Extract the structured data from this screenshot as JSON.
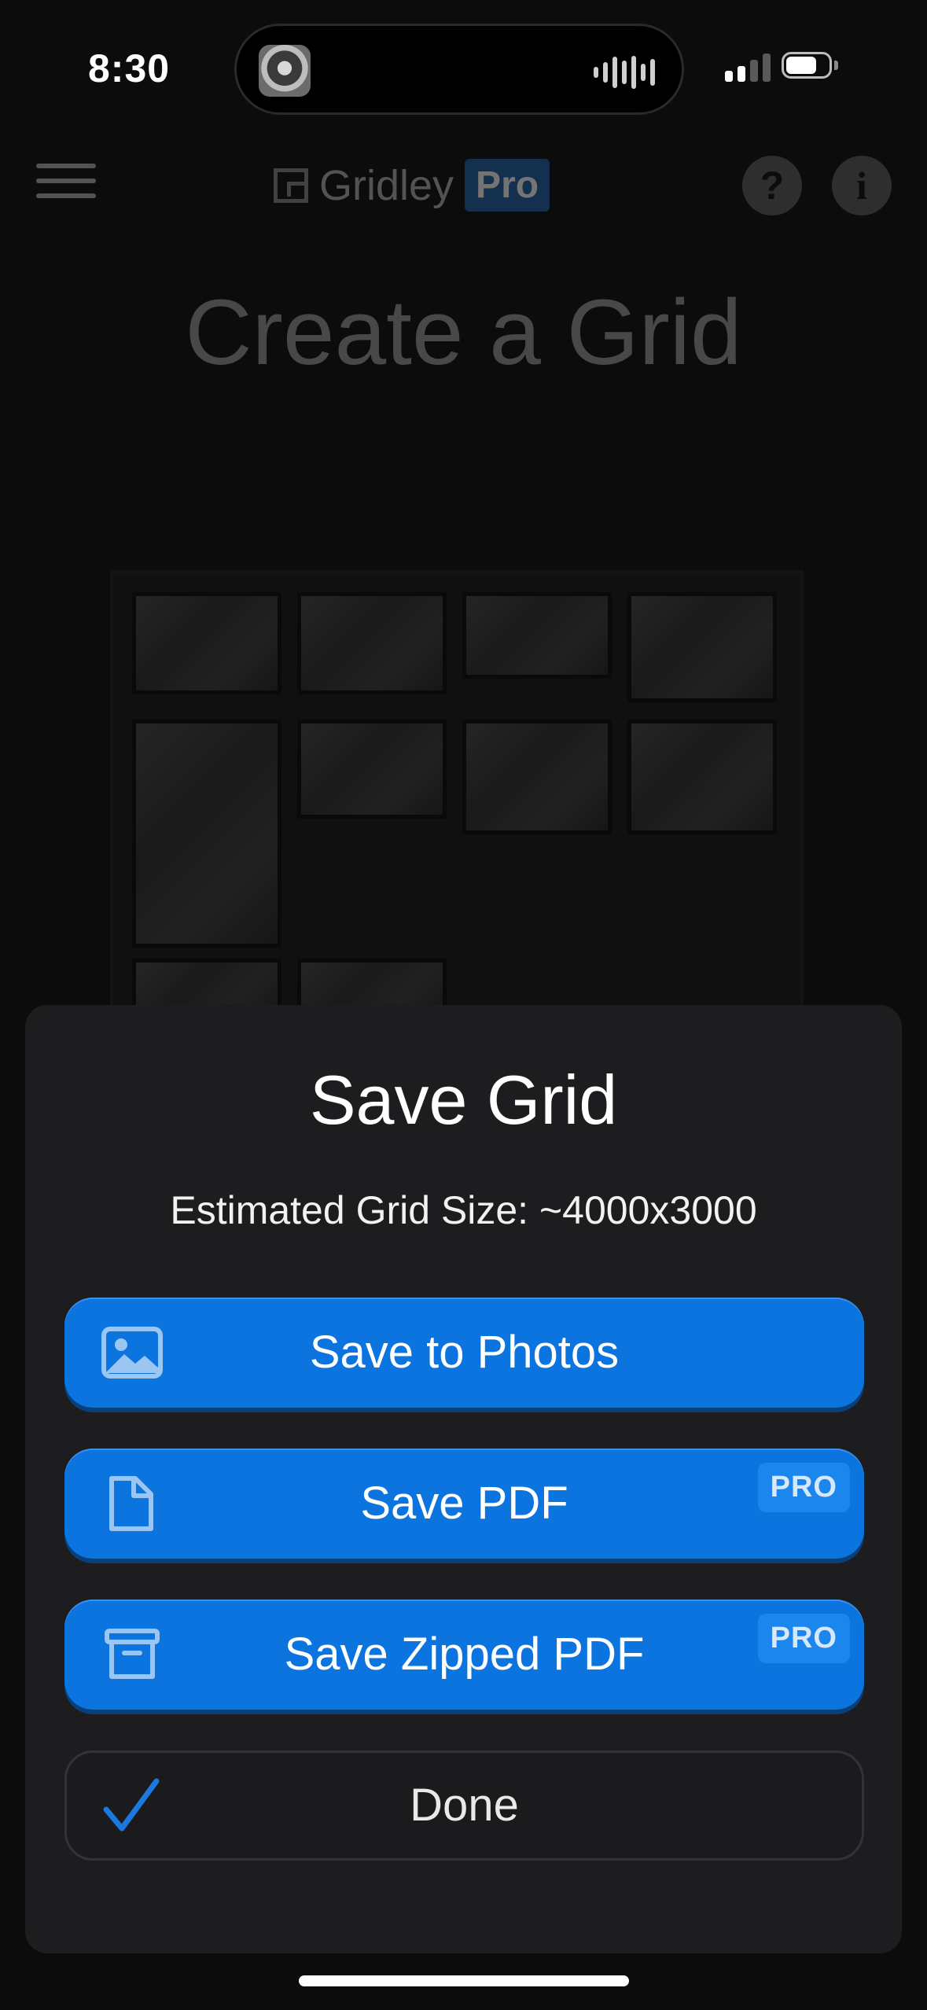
{
  "status_bar": {
    "time": "8:30",
    "signal_bars_active": 2,
    "signal_bars_total": 4
  },
  "header": {
    "menu_icon": "hamburger-icon",
    "logo_text": "Gridley",
    "logo_badge": "Pro",
    "help_icon_glyph": "?",
    "info_icon_glyph": "i"
  },
  "page": {
    "title": "Create a Grid"
  },
  "sheet": {
    "title": "Save Grid",
    "subtitle": "Estimated Grid Size: ~4000x3000",
    "actions": [
      {
        "label": "Save to Photos",
        "icon": "photo-icon",
        "badge": ""
      },
      {
        "label": "Save PDF",
        "icon": "document-icon",
        "badge": "PRO"
      },
      {
        "label": "Save Zipped PDF",
        "icon": "archive-icon",
        "badge": "PRO"
      }
    ],
    "done_label": "Done",
    "done_icon": "checkmark-icon"
  },
  "colors": {
    "accent": "#0b74de",
    "sheet_bg": "#1d1d1f",
    "background": "#0c0c0d",
    "checkmark": "#1a78e0"
  }
}
